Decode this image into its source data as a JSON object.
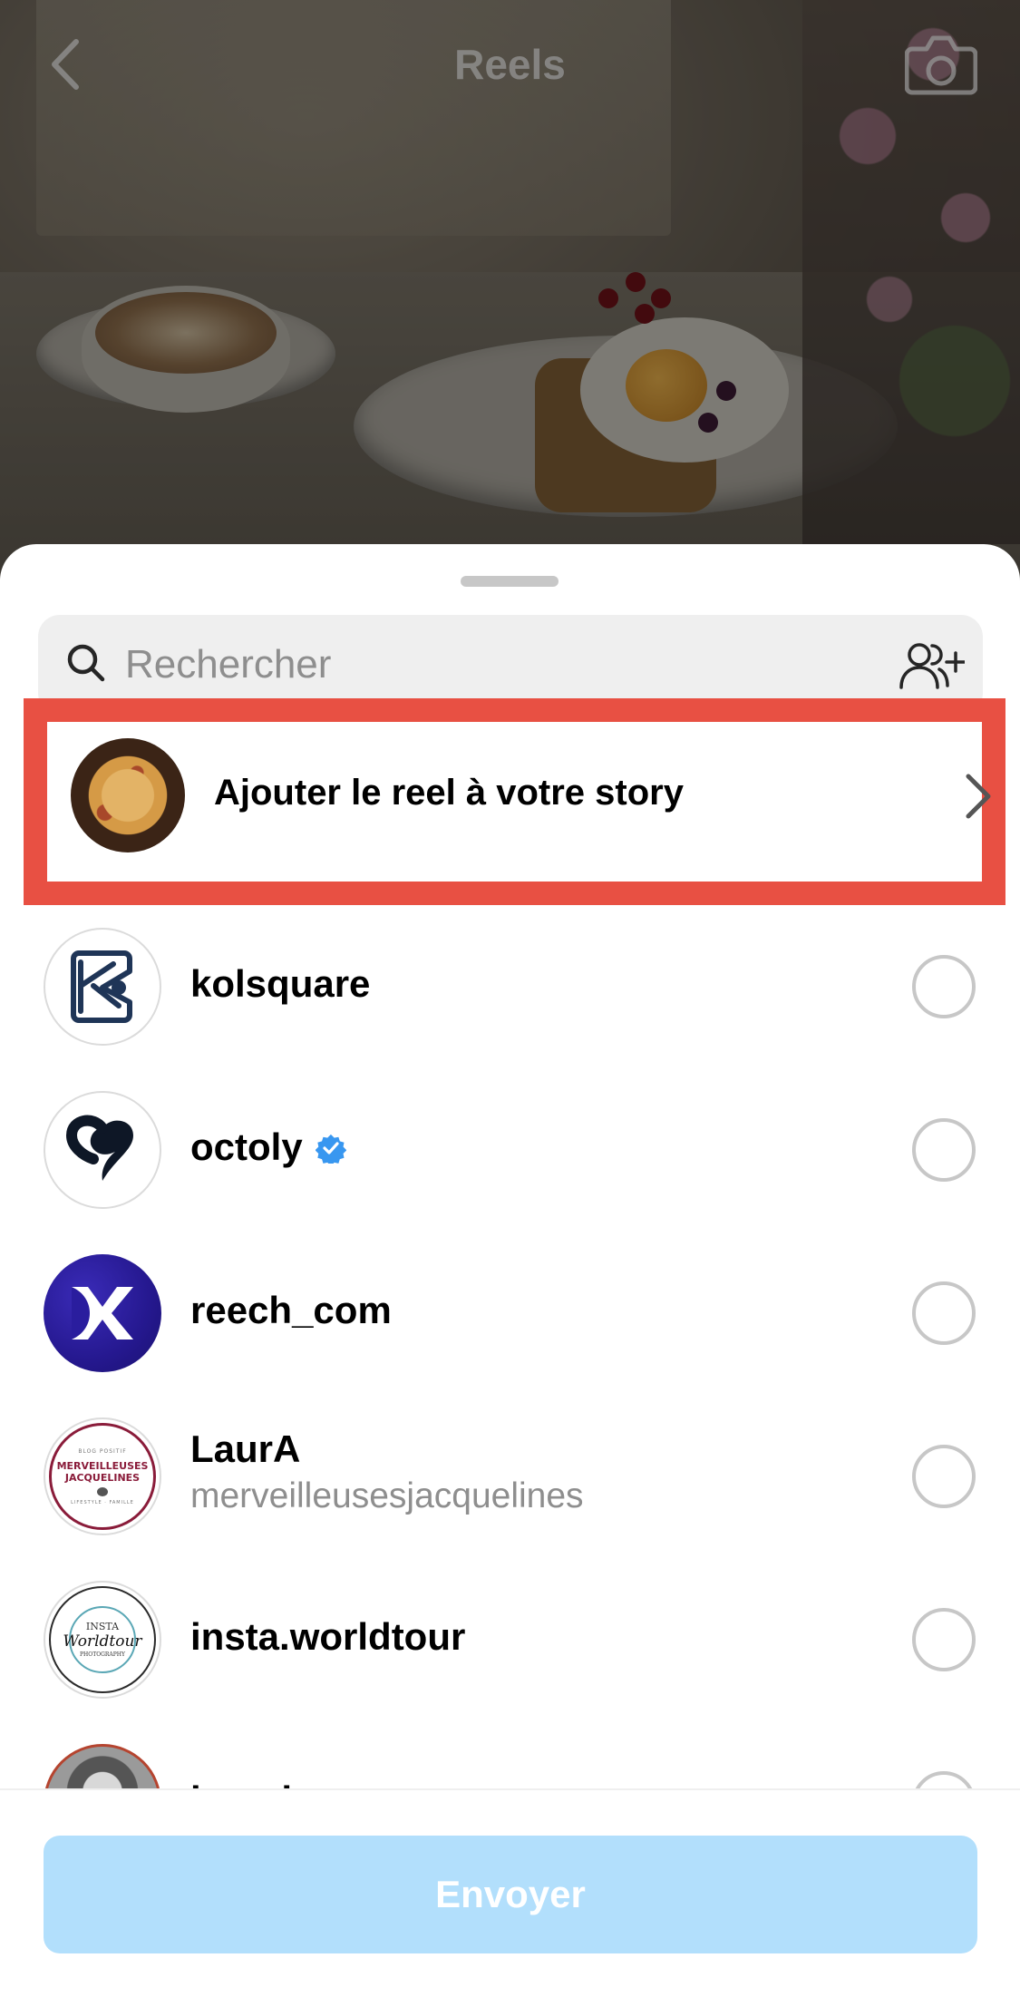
{
  "header": {
    "title": "Reels",
    "back_icon": "back-chevron-icon",
    "camera_icon": "camera-icon"
  },
  "search": {
    "placeholder": "Rechercher",
    "value": "",
    "add_people_icon": "add-people-icon"
  },
  "story_row": {
    "label": "Ajouter le reel à votre story",
    "thumbnail": "pizza-thumbnail",
    "icon": "chevron-right-icon"
  },
  "contacts": [
    {
      "username": "kolsquare",
      "subtitle": "",
      "verified": false,
      "selected": false
    },
    {
      "username": "octoly",
      "subtitle": "",
      "verified": true,
      "selected": false
    },
    {
      "username": "reech_com",
      "subtitle": "",
      "verified": false,
      "selected": false
    },
    {
      "username": "LaurA",
      "subtitle": "merveilleusesjacquelines",
      "verified": false,
      "selected": false
    },
    {
      "username": "insta.worldtour",
      "subtitle": "",
      "verified": false,
      "selected": false
    },
    {
      "username": "leondony",
      "subtitle": "",
      "verified": false,
      "selected": false
    }
  ],
  "avatars": {
    "laura_top": "BLOG POSITIF",
    "laura_line1": "MERVEILLEUSES",
    "laura_line2": "JACQUELINES",
    "laura_bottom": "LIFESTYLE · FAMILLE",
    "worldtour_line1": "INSTA",
    "worldtour_line2": "Worldtour",
    "worldtour_line3": "PHOTOGRAPHY"
  },
  "footer": {
    "send_label": "Envoyer"
  },
  "colors": {
    "highlight": "#e85043",
    "send_button_disabled": "#b2dffc",
    "verified_blue": "#3897f0",
    "text_primary": "#000000",
    "text_secondary": "#8e8e8e"
  }
}
